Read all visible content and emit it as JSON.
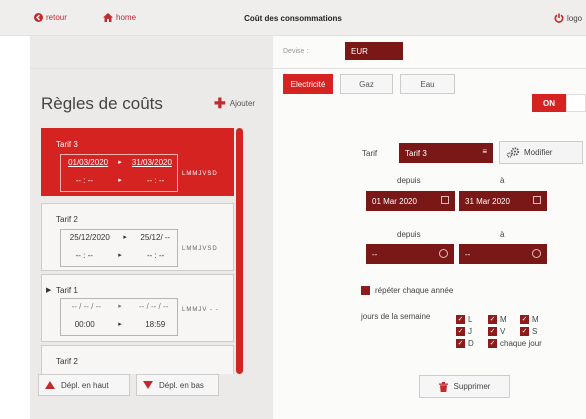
{
  "header": {
    "back_label": "retour",
    "home_label": "home",
    "title": "Coût des consommations",
    "logout_label": "logo"
  },
  "devise": {
    "label": "Devise :",
    "value": "EUR"
  },
  "energy_tabs": [
    {
      "label": "Electricité",
      "active": true
    },
    {
      "label": "Gaz",
      "active": false
    },
    {
      "label": "Eau",
      "active": false
    }
  ],
  "toggle": {
    "label": "ON",
    "state": true
  },
  "rules": {
    "title": "Règles de coûts",
    "add_label": "Ajouter",
    "items": [
      {
        "name": "Tarif 3",
        "from": "01/03/2020",
        "to": "31/03/2020",
        "time_from": "-- : --",
        "time_to": "-- : --",
        "days": "LMMJVSD",
        "active": true,
        "pointer": false
      },
      {
        "name": "Tarif 2",
        "from": "25/12/2020",
        "to": "25/12/ --",
        "time_from": "-- : --",
        "time_to": "-- : --",
        "days": "LMMJVSD",
        "active": false,
        "pointer": false
      },
      {
        "name": "Tarif 1",
        "from": "-- / -- / --",
        "to": "-- / -- / --",
        "time_from": "00:00",
        "time_to": "18:59",
        "days": "LMMJV - -",
        "active": false,
        "pointer": true
      },
      {
        "name": "Tarif 2",
        "from": "",
        "to": "",
        "time_from": "",
        "time_to": "",
        "days": "",
        "active": false,
        "pointer": false
      }
    ]
  },
  "actions": {
    "move_up_label": "Dépl. en haut",
    "move_down_label": "Dépl. en bas",
    "delete_label": "Supprimer"
  },
  "detail": {
    "tarif_label": "Tarif",
    "tarif_value": "Tarif 3",
    "modify_label": "Modifier",
    "date_from_label": "depuis",
    "date_to_label": "à",
    "date_from": "01 Mar 2020",
    "date_to": "31 Mar 2020",
    "time_from_label": "depuis",
    "time_to_label": "à",
    "time_from": "--",
    "time_to": "--",
    "repeat_label": "répéter chaque année",
    "weekdays_label": "jours de la semaine",
    "weekdays": [
      "L",
      "M",
      "M",
      "J",
      "V",
      "S",
      "D"
    ],
    "every_day_label": "chaque jour"
  },
  "colors": {
    "accent": "#d42321",
    "dark": "#7a1717"
  }
}
